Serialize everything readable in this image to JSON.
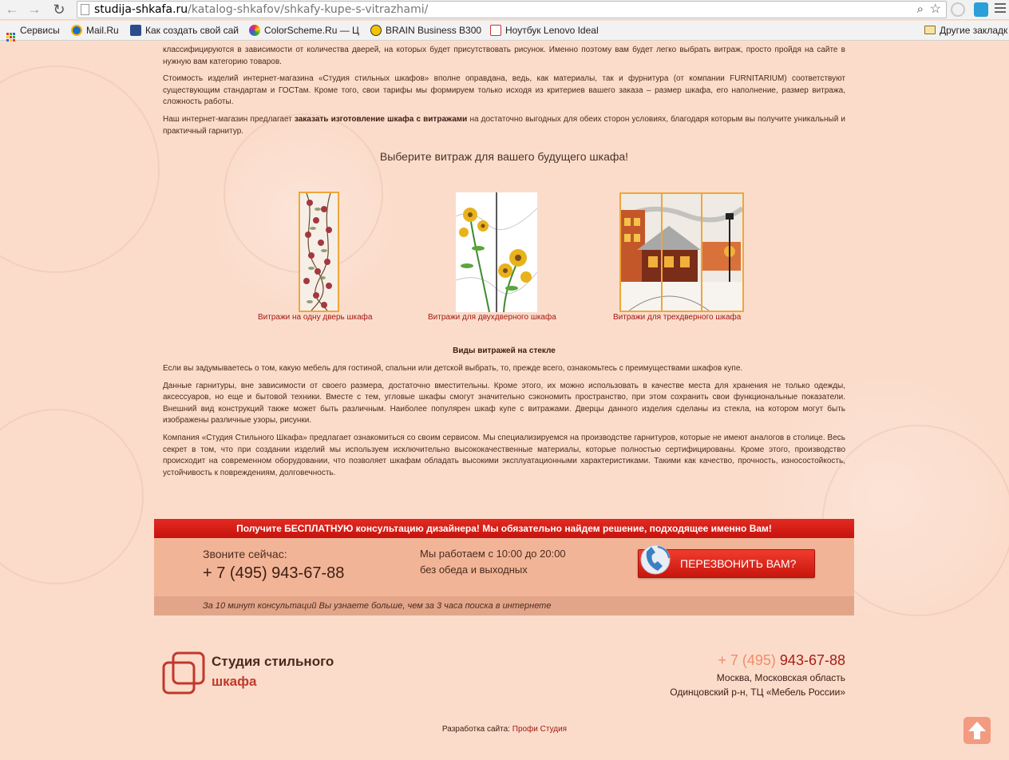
{
  "browser": {
    "url_host": "studija-shkafa.ru",
    "url_path": "/katalog-shkafov/shkafy-kupe-s-vitrazhami/",
    "bookmarks": [
      {
        "label": "Сервисы",
        "icon": "apps-grid-icon"
      },
      {
        "label": "Mail.Ru",
        "icon": "mailru-icon"
      },
      {
        "label": "Как создать свой сай",
        "icon": "site-icon"
      },
      {
        "label": "ColorScheme.Ru — Ц",
        "icon": "colorscheme-icon"
      },
      {
        "label": "BRAIN Business B300",
        "icon": "brain-icon"
      },
      {
        "label": "Ноутбук Lenovo Ideal",
        "icon": "lenovo-icon"
      }
    ],
    "other_bookmarks": "Другие закладк"
  },
  "intro": {
    "p1": "классифицируются в зависимости от количества дверей, на которых будет присутствовать рисунок. Именно поэтому вам будет легко выбрать витраж, просто пройдя на сайте в нужную вам категорию товаров.",
    "p2": "Стоимость изделий интернет-магазина «Студия стильных шкафов» вполне оправдана, ведь, как материалы, так и фурнитура (от компании FURNITARIUM) соответствуют существующим стандартам и ГОСТам. Кроме того, свои тарифы мы формируем только исходя из критериев вашего заказа – размер шкафа, его наполнение, размер витража, сложность работы.",
    "p3_before": "Наш интернет-магазин предлагает ",
    "p3_bold": "заказать изготовление шкафа с витражами",
    "p3_after": " на достаточно выгодных для обеих сторон условиях, благодаря которым вы получите уникальный и практичный гарнитур."
  },
  "choose_title": "Выберите витраж для вашего будущего шкафа!",
  "thumbs": [
    {
      "caption": "Витражи на одну дверь шкафа"
    },
    {
      "caption": "Витражи для двухдверного шкафа"
    },
    {
      "caption": "Витражи для трехдверного шкафа"
    }
  ],
  "types": {
    "title": "Виды витражей на стекле",
    "p1": "Если вы задумываетесь о том, какую мебель для гостиной, спальни или детской выбрать, то, прежде всего, ознакомьтесь с преимуществами шкафов купе.",
    "p2": "Данные гарнитуры, вне зависимости от своего размера, достаточно вместительны. Кроме этого, их можно использовать в качестве места для хранения не только одежды, аксессуаров, но еще и бытовой техники. Вместе с тем, угловые шкафы смогут значительно сэкономить пространство, при этом сохранить свои функциональные показатели. Внешний вид конструкций также может быть различным. Наиболее популярен шкаф купе с витражами. Дверцы данного изделия сделаны из стекла, на котором могут быть изображены различные узоры, рисунки.",
    "p3": "Компания «Студия Стильного Шкафа» предлагает ознакомиться со своим сервисом. Мы специализируемся на производстве гарнитуров, которые не имеют аналогов в столице. Весь секрет в том, что при создании изделий мы используем исключительно высококачественные материалы, которые полностью сертифицированы. Кроме этого, производство происходит на современном оборудовании, что позволяет шкафам обладать высокими эксплуатационными характеристиками. Такими как качество, прочность, износостойкость, устойчивость к повреждениям, долговечность."
  },
  "consult": {
    "headline": "Получите БЕСПЛАТНУЮ консультацию дизайнера! Мы обязательно найдем решение, подходящее именно Вам!",
    "call_label": "Звоните сейчас:",
    "phone": "+ 7 (495) 943-67-88",
    "hours_1": "Мы работаем с 10:00 до 20:00",
    "hours_2": "без обеда и выходных",
    "button": "ПЕРЕЗВОНИТЬ ВАМ?",
    "tagline": "За 10 минут консультаций Вы узнаете больше, чем за 3 часа поиска в интернете"
  },
  "footer": {
    "logo_line1": "Студия стильного",
    "logo_line2": "шкафа",
    "phone_code": "+ 7 (495)",
    "phone_num": "943-67-88",
    "addr_1": "Москва, Московская область",
    "addr_2": "Одинцовский р-н, ТЦ «Мебель России»",
    "dev_label": "Разработка сайта:",
    "dev_link": "Профи Студия"
  },
  "colors": {
    "accent_red": "#c6130d",
    "page_bg": "#fbdccb",
    "link": "#a21a12"
  }
}
